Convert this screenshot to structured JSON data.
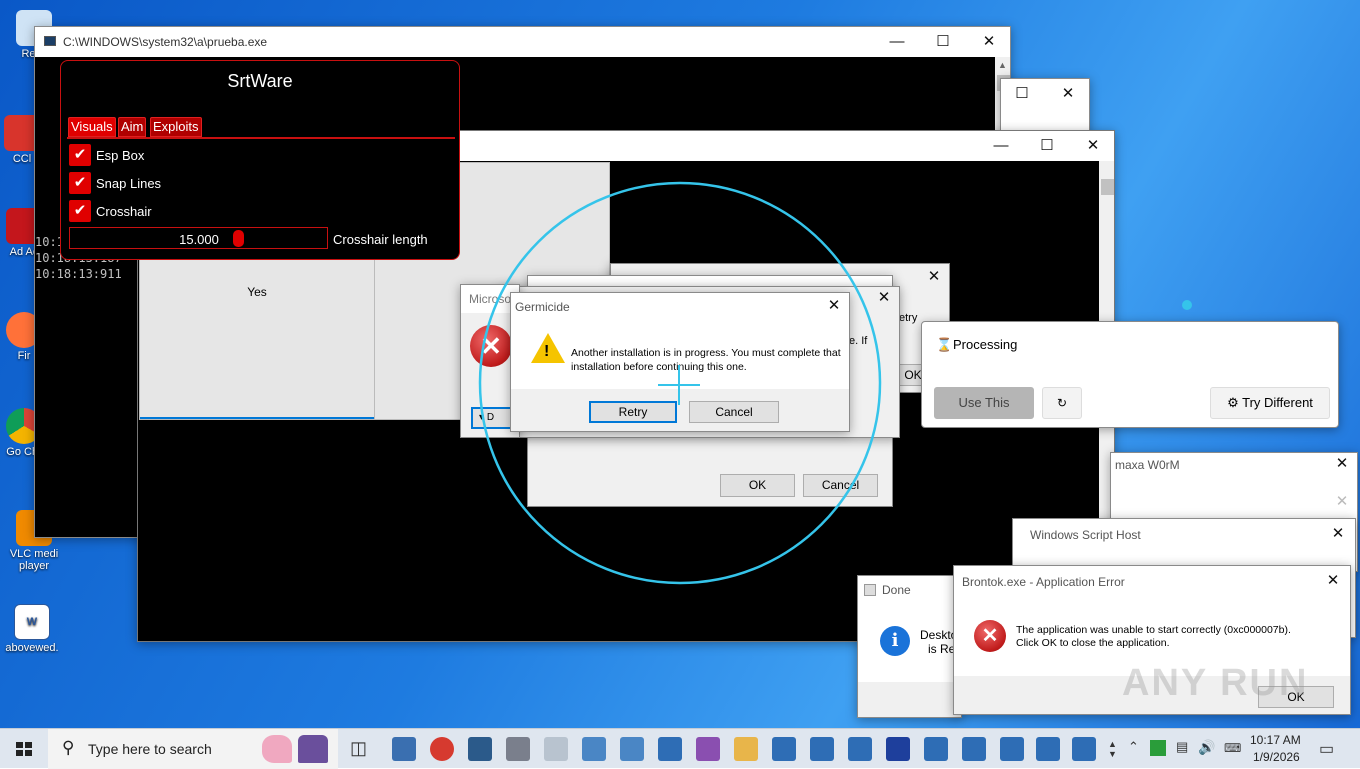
{
  "desktop": {
    "icons": [
      {
        "label": "Recy",
        "name": "recycle-bin"
      },
      {
        "label": "CCl",
        "name": "ccleaner"
      },
      {
        "label": "Ad Ac",
        "name": "acrobat"
      },
      {
        "label": "Fir",
        "name": "firefox"
      },
      {
        "label": "Go Chr",
        "name": "chrome"
      },
      {
        "label": "VLC medi player",
        "name": "vlc"
      },
      {
        "label": "abovewed.",
        "name": "word-doc"
      }
    ]
  },
  "console": {
    "title": "C:\\WINDOWS\\system32\\a\\prueba.exe",
    "lines": [
      "10:1",
      "10:18:13:187",
      "10:18:13:911"
    ]
  },
  "srtware": {
    "title": "SrtWare",
    "tabs": [
      "Visuals",
      "Aim",
      "Exploits"
    ],
    "checks": [
      "Esp Box",
      "Snap Lines",
      "Crosshair"
    ],
    "slider_value": "15.000",
    "slider_label": "Crosshair length"
  },
  "yes_window": {
    "yes": "Yes"
  },
  "microsoft": {
    "title": "Microso",
    "btn": "D"
  },
  "germicide": {
    "title": "Germicide",
    "message": "Another installation is in progress. You must complete that installation before continuing this one.",
    "retry": "Retry",
    "cancel": "Cancel"
  },
  "behind_dialog": {
    "frag1": "etry",
    "frag2": "e. If",
    "ok_frag": "OK",
    "ok": "OK",
    "cancel": "Cancel"
  },
  "processing": {
    "title": "Processing",
    "use_this": "Use This",
    "refresh": "↻",
    "try_different": "Try Different"
  },
  "maxa": {
    "title": "maxa W0rM"
  },
  "wsh": {
    "title": "Windows Script Host"
  },
  "done": {
    "title": "Done",
    "text1": "Deskto",
    "text2": "is Re"
  },
  "brontok": {
    "title": "Brontok.exe - Application Error",
    "line1": "The application was unable to start correctly (0xc000007b).",
    "line2": "Click OK to close the application.",
    "ok": "OK"
  },
  "watermark": "ANY RUN",
  "taskbar": {
    "search_placeholder": "Type here to search",
    "time": "10:17 AM",
    "date": "1/9/2026"
  },
  "colors": {
    "accent": "#0078d7",
    "srt_red": "#e00000",
    "circle": "#35c4ea"
  }
}
